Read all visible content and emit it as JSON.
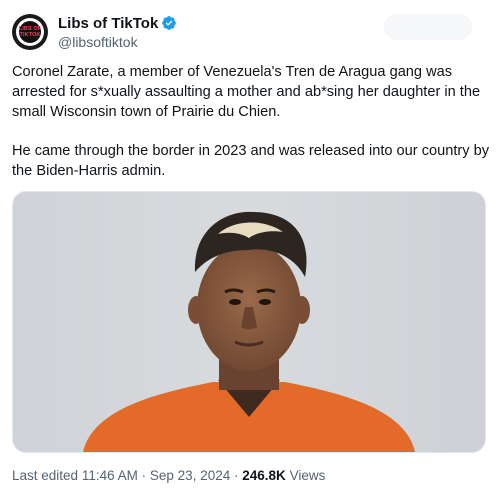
{
  "author": {
    "display_name": "Libs of TikTok",
    "handle": "@libsoftiktok",
    "avatar_icon": "libs-of-tiktok-logo",
    "verified": true,
    "verified_color": "#1d9bf0"
  },
  "tweet": {
    "paragraphs": [
      "Coronel Zarate, a member of Venezuela's Tren de Aragua gang was arrested for s*xually assaulting a mother and ab*sing her daughter in the small Wisconsin town of Prairie du Chien.",
      "He came through the border in 2023 and was released into our country by the Biden-Harris admin."
    ],
    "media": {
      "description_icon": "mugshot-photo",
      "shirt_color": "#e46a2a",
      "background_color": "#d3d6d9"
    }
  },
  "meta": {
    "edited_label": "Last edited",
    "time": "11:46 AM",
    "separator": "·",
    "date": "Sep 23, 2024",
    "views_count": "246.8K",
    "views_label": "Views"
  }
}
